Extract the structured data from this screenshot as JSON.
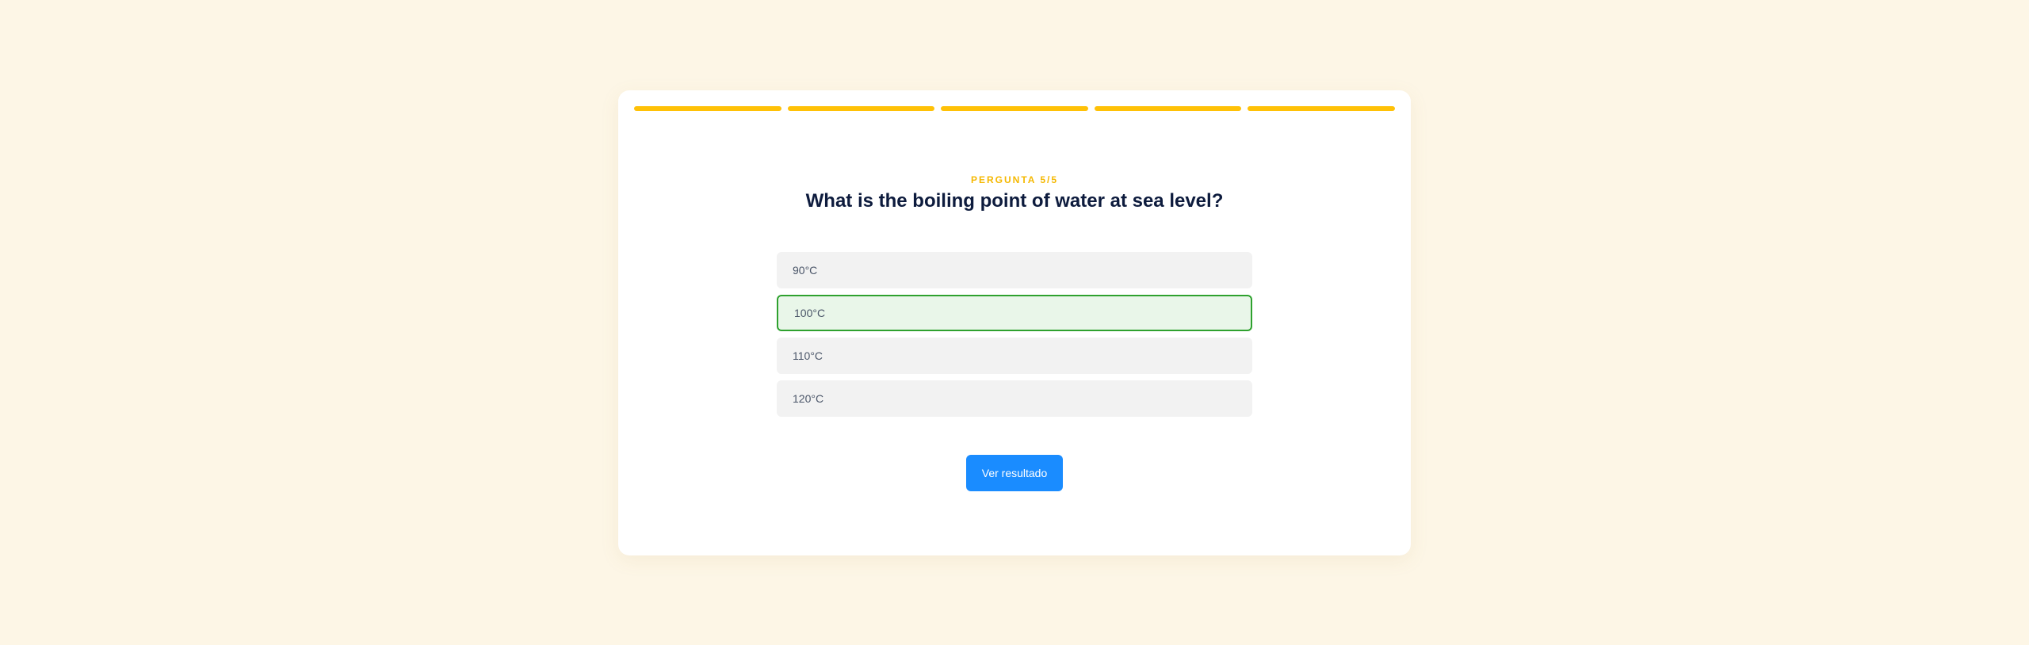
{
  "quiz": {
    "progress": {
      "total_steps": 5,
      "completed_steps": 5,
      "color": "#ffc107"
    },
    "counter_label": "PERGUNTA 5/5",
    "question": "What is the boiling point of water at sea level?",
    "options": [
      {
        "label": "90°C",
        "selected": false
      },
      {
        "label": "100°C",
        "selected": true
      },
      {
        "label": "110°C",
        "selected": false
      },
      {
        "label": "120°C",
        "selected": false
      }
    ],
    "submit_label": "Ver resultado"
  },
  "colors": {
    "page_background": "#fdf6e6",
    "accent": "#ffc107",
    "selected_border": "#2ea12e",
    "selected_background": "#e9f6e9",
    "button": "#1a8cff",
    "question_text": "#0d1b3d"
  }
}
